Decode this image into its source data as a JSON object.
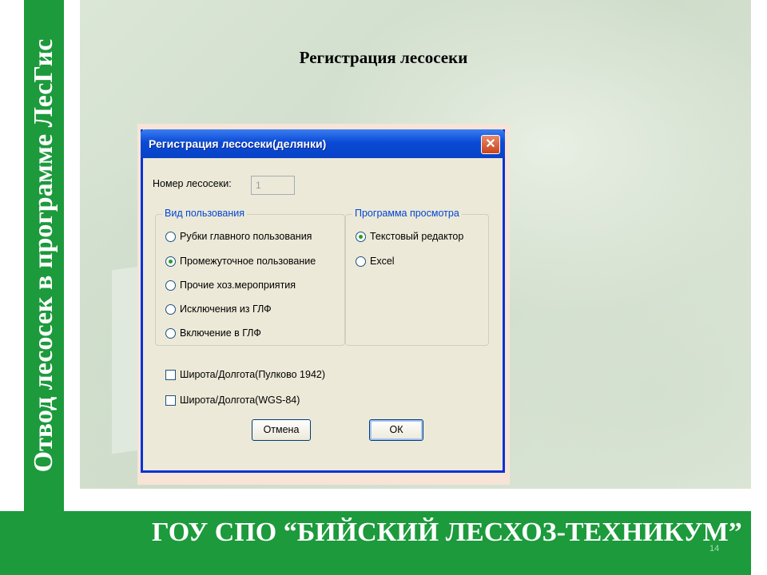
{
  "slide": {
    "side_title": "Отвод лесосек в программе ЛесГис",
    "title": "Регистрация лесосеки",
    "footer": "ГОУ СПО “БИЙСКИЙ ЛЕСХОЗ-ТЕХНИКУМ”",
    "page_number": "14"
  },
  "dialog": {
    "title": "Регистрация лесосеки(делянки)",
    "close_icon": "close-icon",
    "number_label": "Номер лесосеки:",
    "number_value": "1",
    "usage_group": {
      "legend": "Вид пользования",
      "options": [
        {
          "label": "Рубки главного пользования",
          "checked": false
        },
        {
          "label": "Промежуточное пользование",
          "checked": true
        },
        {
          "label": "Прочие хоз.мероприятия",
          "checked": false
        },
        {
          "label": "Исключения из ГЛФ",
          "checked": false
        },
        {
          "label": "Включение в ГЛФ",
          "checked": false
        }
      ]
    },
    "viewer_group": {
      "legend": "Программа просмотра",
      "options": [
        {
          "label": "Текстовый редактор",
          "checked": true
        },
        {
          "label": "Excel",
          "checked": false
        }
      ]
    },
    "checkboxes": [
      {
        "label": "Широта/Долгота(Пулково 1942)",
        "checked": false
      },
      {
        "label": "Широта/Долгота(WGS-84)",
        "checked": false
      }
    ],
    "cancel_label": "Отмена",
    "ok_label": "ОК"
  }
}
